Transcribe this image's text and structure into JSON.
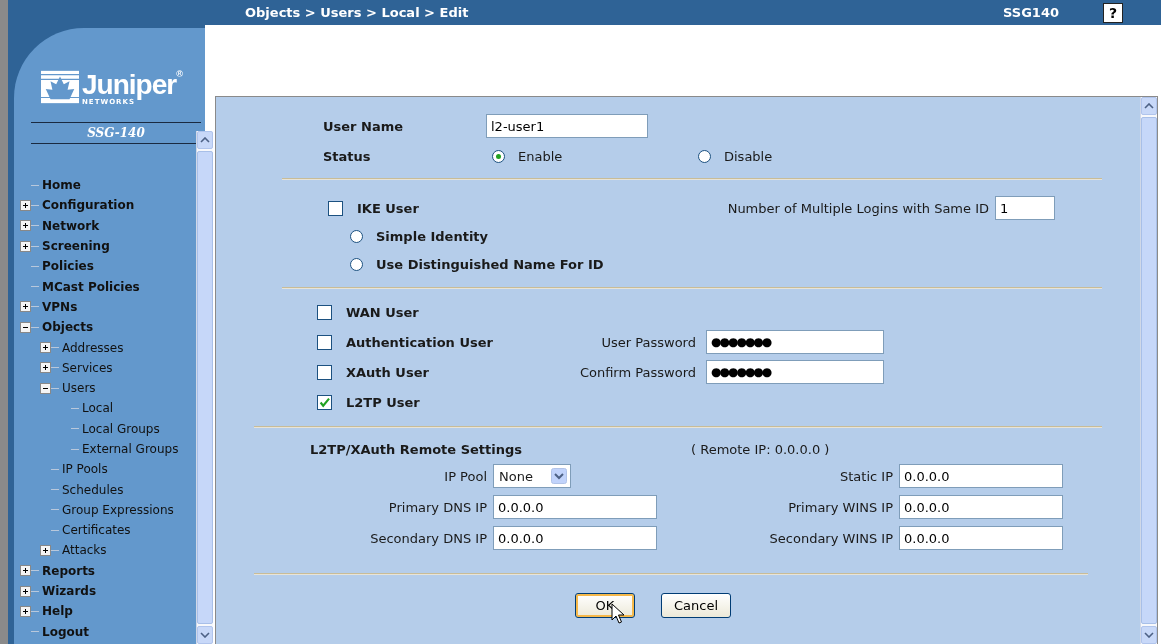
{
  "header": {
    "breadcrumb": "Objects > Users > Local > Edit",
    "device": "SSG140",
    "help_button": "?"
  },
  "logo": {
    "name": "Juniper$^{®}$",
    "sub": "NETWORKS",
    "model": "SSG-140"
  },
  "nav": [
    {
      "label": "Home"
    },
    {
      "label": "Configuration",
      "expanded": false
    },
    {
      "label": "Network",
      "expanded": false
    },
    {
      "label": "Screening",
      "expanded": false
    },
    {
      "label": "Policies"
    },
    {
      "label": "MCast Policies"
    },
    {
      "label": "VPNs",
      "expanded": false
    },
    {
      "label": "Objects",
      "expanded": true,
      "children": [
        {
          "label": "Addresses",
          "expanded": false
        },
        {
          "label": "Services",
          "expanded": false
        },
        {
          "label": "Users",
          "expanded": true,
          "children": [
            {
              "label": "Local"
            },
            {
              "label": "Local Groups"
            },
            {
              "label": "External Groups"
            }
          ]
        },
        {
          "label": "IP Pools"
        },
        {
          "label": "Schedules"
        },
        {
          "label": "Group Expressions"
        },
        {
          "label": "Certificates"
        },
        {
          "label": "Attacks",
          "expanded": false
        }
      ]
    },
    {
      "label": "Reports",
      "expanded": false
    },
    {
      "label": "Wizards",
      "expanded": false
    },
    {
      "label": "Help",
      "expanded": false
    },
    {
      "label": "Logout"
    }
  ],
  "form": {
    "user_name": {
      "label": "User Name",
      "value": "l2-user1"
    },
    "status": {
      "label": "Status",
      "options": [
        {
          "label": "Enable",
          "selected": true
        },
        {
          "label": "Disable",
          "selected": false
        }
      ]
    },
    "ike": {
      "label": "IKE User",
      "checked": false,
      "identity_options": [
        {
          "label": "Simple Identity",
          "selected": false
        },
        {
          "label": "Use Distinguished Name For ID",
          "selected": false
        }
      ],
      "logins": {
        "label": "Number of Multiple Logins with Same ID",
        "value": "1"
      }
    },
    "user_types": [
      {
        "label": "WAN User",
        "checked": false
      },
      {
        "label": "Authentication User",
        "checked": false,
        "field": {
          "label": "User Password",
          "value": "●●●●●●●"
        }
      },
      {
        "label": "XAuth User",
        "checked": false,
        "field": {
          "label": "Confirm Password",
          "value": "●●●●●●●"
        }
      },
      {
        "label": "L2TP User",
        "checked": true
      }
    ],
    "remote": {
      "title": "L2TP/XAuth Remote Settings",
      "remote_ip": "( Remote IP: 0.0.0.0 )",
      "fields": [
        {
          "label": "IP Pool",
          "kind": "select",
          "value": "None"
        },
        {
          "label": "Static IP",
          "kind": "text",
          "value": "0.0.0.0"
        },
        {
          "label": "Primary DNS IP",
          "kind": "text",
          "value": "0.0.0.0"
        },
        {
          "label": "Primary WINS IP",
          "kind": "text",
          "value": "0.0.0.0"
        },
        {
          "label": "Secondary DNS IP",
          "kind": "text",
          "value": "0.0.0.0"
        },
        {
          "label": "Secondary WINS IP",
          "kind": "text",
          "value": "0.0.0.0"
        }
      ]
    }
  },
  "buttons": [
    {
      "label": "OK",
      "focused": true
    },
    {
      "label": "Cancel",
      "focused": false
    }
  ]
}
